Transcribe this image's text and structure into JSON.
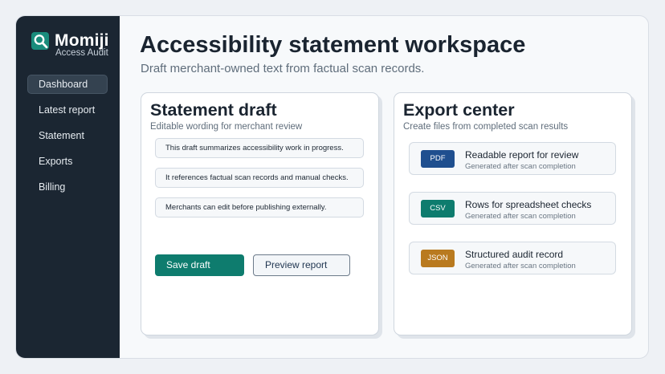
{
  "brand": {
    "name": "Momiji",
    "subtitle": "Access Audit",
    "logo_icon": "magnifier-icon"
  },
  "sidebar": {
    "items": [
      {
        "label": "Dashboard",
        "active": true
      },
      {
        "label": "Latest report",
        "active": false
      },
      {
        "label": "Statement",
        "active": false
      },
      {
        "label": "Exports",
        "active": false
      },
      {
        "label": "Billing",
        "active": false
      }
    ]
  },
  "main": {
    "title": "Accessibility statement workspace",
    "subtitle": "Draft merchant-owned text from factual scan records."
  },
  "draft": {
    "title": "Statement draft",
    "subtitle": "Editable wording for merchant review",
    "lines": [
      "This draft summarizes accessibility work in progress.",
      "It references factual scan records and manual checks.",
      "Merchants can edit before publishing externally."
    ],
    "save_label": "Save draft",
    "preview_label": "Preview report"
  },
  "exports": {
    "title": "Export center",
    "subtitle": "Create files from completed scan results",
    "items": [
      {
        "badge": "PDF",
        "badge_color": "#1f4f8f",
        "title": "Readable report for review",
        "subtitle": "Generated after scan completion"
      },
      {
        "badge": "CSV",
        "badge_color": "#0e7c6e",
        "title": "Rows for spreadsheet checks",
        "subtitle": "Generated after scan completion"
      },
      {
        "badge": "JSON",
        "badge_color": "#b97a1f",
        "title": "Structured audit record",
        "subtitle": "Generated after scan completion"
      }
    ]
  },
  "colors": {
    "sidebar_bg": "#1b2632",
    "accent": "#0e7c6e",
    "pdf": "#1f4f8f",
    "csv": "#0e7c6e",
    "json": "#b97a1f"
  }
}
